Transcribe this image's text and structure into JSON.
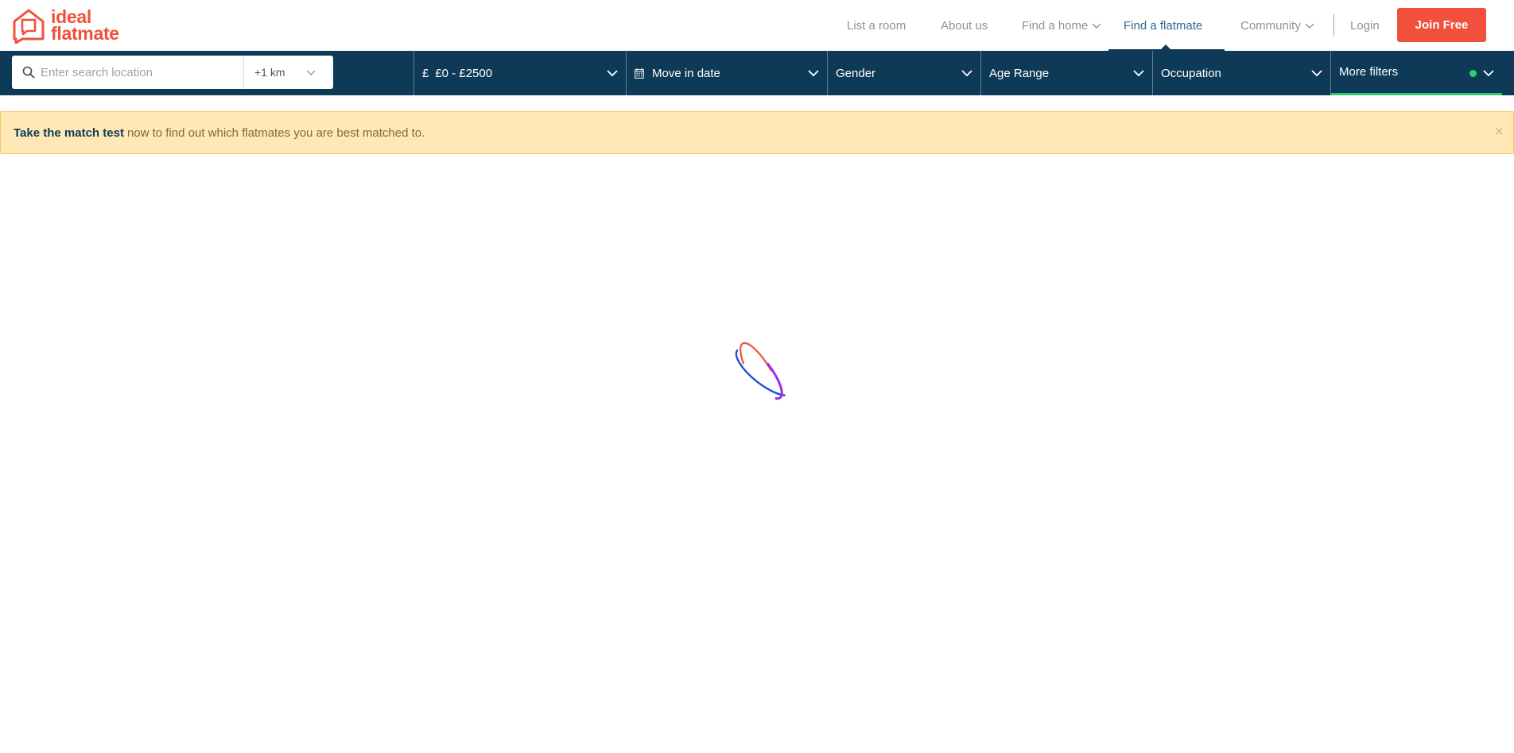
{
  "brand": {
    "line1": "ideal",
    "line2": "flatmate",
    "color": "#f0503c"
  },
  "nav": {
    "items": [
      {
        "label": "List a room",
        "has_dropdown": false
      },
      {
        "label": "About us",
        "has_dropdown": false
      },
      {
        "label": "Find a home",
        "has_dropdown": true
      },
      {
        "label": "Find a flatmate",
        "has_dropdown": false,
        "active": true
      },
      {
        "label": "Community",
        "has_dropdown": true
      }
    ],
    "login_label": "Login",
    "join_label": "Join Free"
  },
  "filters": {
    "search_placeholder": "Enter search location",
    "search_value": "",
    "radius": "+1 km",
    "budget_icon": "£",
    "budget": "£0 - £2500",
    "move_in_label": "Move in date",
    "gender_label": "Gender",
    "age_label": "Age Range",
    "occupation_label": "Occupation",
    "more_label": "More filters"
  },
  "notice": {
    "link_text": "Take the match test",
    "text": "now to find out which flatmates you are best matched to.",
    "close_glyph": "×"
  },
  "colors": {
    "navy": "#0f3a57",
    "coral": "#f0503c",
    "green": "#2ecc71",
    "notice_bg": "#ffe8b5"
  },
  "main": {
    "loading": true
  }
}
